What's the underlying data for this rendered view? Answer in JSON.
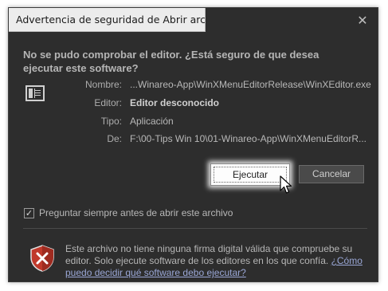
{
  "window": {
    "title": "Advertencia de seguridad de Abrir archivo",
    "close_glyph": "✕"
  },
  "heading": "No se pudo comprobar el editor. ¿Está seguro de que desea ejecutar este software?",
  "info": {
    "name_label": "Nombre:",
    "name_value": "...Winareo-App\\WinXMenuEditorRelease\\WinXEditor.exe",
    "publisher_label": "Editor:",
    "publisher_value": "Editor desconocido",
    "type_label": "Tipo:",
    "type_value": "Aplicación",
    "from_label": "De:",
    "from_value": "F:\\00-Tips Win 10\\01-Winareo-App\\WinXMenuEditorR..."
  },
  "buttons": {
    "run": "Ejecutar",
    "cancel": "Cancelar"
  },
  "checkbox": {
    "label": "Preguntar siempre antes de abrir este archivo",
    "checked": true,
    "check_glyph": "✓"
  },
  "warning": {
    "text": "Este archivo no tiene ninguna firma digital válida que compruebe su editor. Solo ejecute software de los editores en los que confía.",
    "link": "¿Cómo puedo decidir qué software debo ejecutar?"
  },
  "icons": {
    "file": "application-file-icon",
    "shield": "security-shield-icon",
    "cursor": "mouse-pointer-icon"
  },
  "colors": {
    "dialog_bg": "#2d2d2d",
    "title_bg": "#ececec",
    "text": "#b8b8b8",
    "link": "#9aa7d6",
    "shield_red": "#c0392b"
  }
}
